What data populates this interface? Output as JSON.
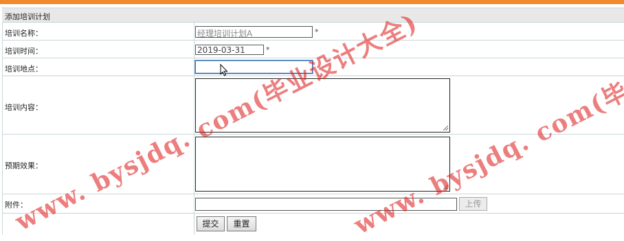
{
  "form": {
    "title": "添加培训计划",
    "fields": {
      "name": {
        "label": "培训名称：",
        "value": "经理培训计划A",
        "required_mark": "*"
      },
      "date": {
        "label": "培训时间：",
        "value": "2019-03-31",
        "required_mark": "*"
      },
      "location": {
        "label": "培训地点：",
        "value": ""
      },
      "content": {
        "label": "培训内容：",
        "value": ""
      },
      "effect": {
        "label": "预期效果：",
        "value": ""
      },
      "attachment": {
        "label": "附件：",
        "value": "",
        "upload_label": "上传"
      }
    },
    "buttons": {
      "submit": "提交",
      "reset": "重置"
    }
  },
  "watermark": {
    "text1": "www. bysjdq. com(毕业设计大全)",
    "text2": "www. bysjdq. com(毕业设计大"
  },
  "colors": {
    "accent_bar": "#f08a2c",
    "watermark": "#dc1414",
    "focus_border": "#3b6fb6"
  }
}
